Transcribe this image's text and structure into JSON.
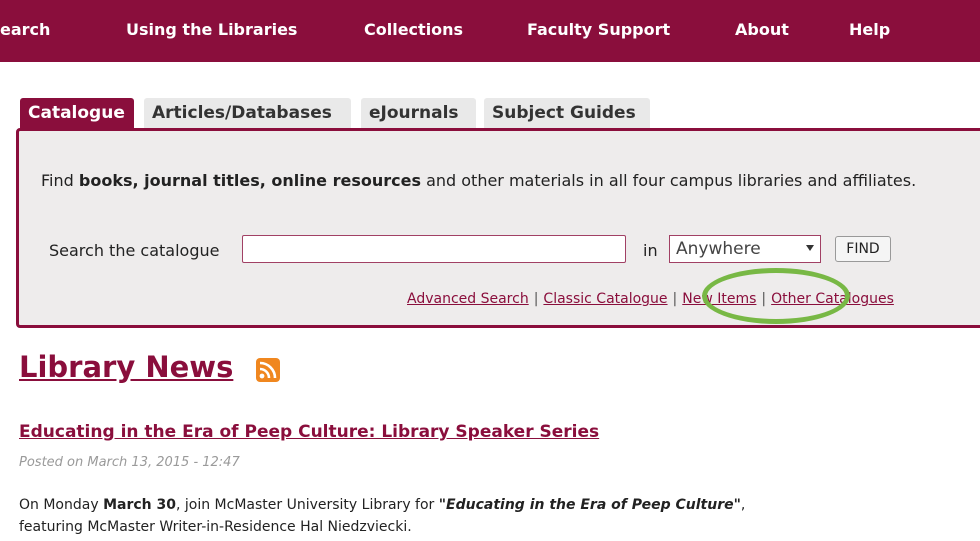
{
  "nav": {
    "items": [
      "earch",
      "Using the Libraries",
      "Collections",
      "Faculty Support",
      "About",
      "Help"
    ]
  },
  "tabs": [
    "Catalogue",
    "Articles/Databases",
    "eJournals",
    "Subject Guides"
  ],
  "panel": {
    "desc_prefix": "Find ",
    "desc_bold": "books, journal titles, online resources",
    "desc_suffix": " and other materials in all four campus libraries and affiliates.",
    "search_label": "Search the catalogue",
    "search_value": "",
    "in_label": "in",
    "scope_selected": "Anywhere",
    "find_label": "FIND",
    "links": [
      "Advanced Search",
      "Classic Catalogue",
      "New Items",
      "Other Catalogues"
    ],
    "link_separator": "|"
  },
  "news": {
    "title": "Library News",
    "rss_icon": "rss-feed-icon",
    "post_title": "Educating in the Era of Peep Culture: Library Speaker Series",
    "post_date": "Posted on March 13, 2015 - 12:47",
    "body_1": "On Monday ",
    "body_date": "March 30",
    "body_2": ", join McMaster University Library for ",
    "body_event": "\"Educating in the Era of Peep Culture\"",
    "body_3": ",",
    "body_4": "featuring McMaster Writer-in-Residence Hal Niedzviecki."
  },
  "colors": {
    "brand": "#8a0e3c",
    "highlight": "#78b845",
    "rss": "#f0871f"
  }
}
